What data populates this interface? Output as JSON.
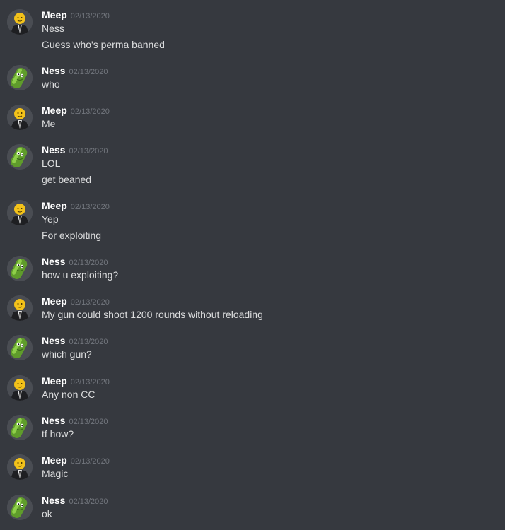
{
  "users": {
    "meep": {
      "name": "Meep",
      "avatar_icon": "suit-man-emoji-head-avatar",
      "avatar_colors": {
        "head": "#f3c21a",
        "suit": "#1e1f22",
        "shirt": "#e8e8e8",
        "tie": "#151515"
      }
    },
    "ness": {
      "name": "Ness",
      "avatar_icon": "pickle-avatar",
      "avatar_colors": {
        "body": "#5f9c2b",
        "dark": "#3a6a1a",
        "light": "#8fcf4a"
      }
    }
  },
  "colors": {
    "background": "#36393f",
    "username": "#ffffff",
    "timestamp": "#72767d",
    "message_text": "#dcddde"
  },
  "messages": [
    {
      "author": "Meep",
      "timestamp": "02/13/2020",
      "lines": [
        "Ness",
        "Guess who's perma banned"
      ]
    },
    {
      "author": "Ness",
      "timestamp": "02/13/2020",
      "lines": [
        "who"
      ]
    },
    {
      "author": "Meep",
      "timestamp": "02/13/2020",
      "lines": [
        "Me"
      ]
    },
    {
      "author": "Ness",
      "timestamp": "02/13/2020",
      "lines": [
        "LOL",
        "get beaned"
      ]
    },
    {
      "author": "Meep",
      "timestamp": "02/13/2020",
      "lines": [
        "Yep",
        "For exploiting"
      ]
    },
    {
      "author": "Ness",
      "timestamp": "02/13/2020",
      "lines": [
        "how u exploiting?"
      ]
    },
    {
      "author": "Meep",
      "timestamp": "02/13/2020",
      "lines": [
        "My gun could shoot 1200 rounds without reloading"
      ]
    },
    {
      "author": "Ness",
      "timestamp": "02/13/2020",
      "lines": [
        "which gun?"
      ]
    },
    {
      "author": "Meep",
      "timestamp": "02/13/2020",
      "lines": [
        "Any non CC"
      ]
    },
    {
      "author": "Ness",
      "timestamp": "02/13/2020",
      "lines": [
        "tf how?"
      ]
    },
    {
      "author": "Meep",
      "timestamp": "02/13/2020",
      "lines": [
        "Magic"
      ]
    },
    {
      "author": "Ness",
      "timestamp": "02/13/2020",
      "lines": [
        "ok"
      ]
    }
  ]
}
